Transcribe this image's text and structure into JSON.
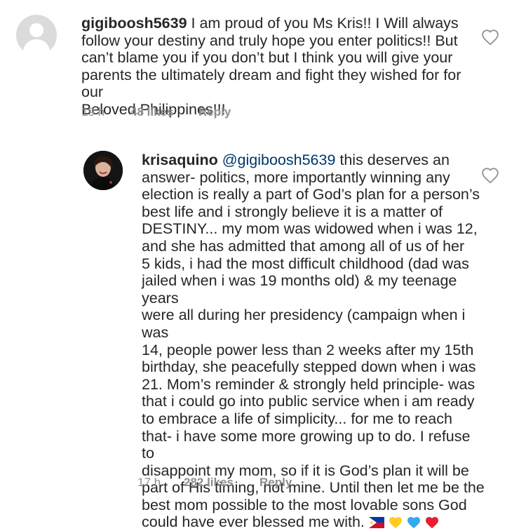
{
  "comments": [
    {
      "username": "gigiboosh5639",
      "lines": [
        "I am proud of you Ms Kris!! I Will always",
        "follow your destiny and truly hope you enter politics!! But",
        "can’t blame you if you don’t but I think you will give your",
        "parents the ultimately dream and fight they wished for for our",
        "Beloved Philippines!!!"
      ],
      "time": "19 h",
      "likes": "48 likes",
      "reply": "Reply"
    },
    {
      "username": "krisaquino",
      "mention": "@gigiboosh5639",
      "first_line_rest": " this deserves an",
      "lines": [
        "answer- politics, more importantly winning any",
        "election is really a part of God’s plan for a person’s",
        "best life and i strongly believe it is a matter of",
        "DESTINY... my mom was widowed when i was 12,",
        "and she has admitted that among all of us of her",
        "5 kids, i had the most difficult childhood (dad was",
        "jailed when i was 19 months old) & my teenage years",
        "were all during her presidency (campaign when i was",
        "14, people power less than 2 weeks after my 15th",
        "birthday, she peacefully stepped down when i was",
        "21. Mom’s reminder & strongly held principle- was",
        "that i could go into public service when i am ready",
        "to embrace a life of simplicity... for me to reach",
        "that- i have some more growing up to do. I refuse to",
        "disappoint my mom, so if it is God’s plan it will be",
        "part of His timing, not mine. Until then let me be the",
        "best mom possible to the most lovable sons God"
      ],
      "last_line": "could have ever blessed me with.",
      "emojis": [
        "philippines-flag-emoji",
        "yellow-heart-emoji",
        "blue-heart-emoji",
        "red-heart-emoji"
      ],
      "time": "17 h",
      "likes": "282 likes",
      "reply": "Reply"
    }
  ],
  "colors": {
    "text": "#262626",
    "meta": "#8e8e8e",
    "mention": "#00376b",
    "heart_outline": "#8e8e8e"
  }
}
